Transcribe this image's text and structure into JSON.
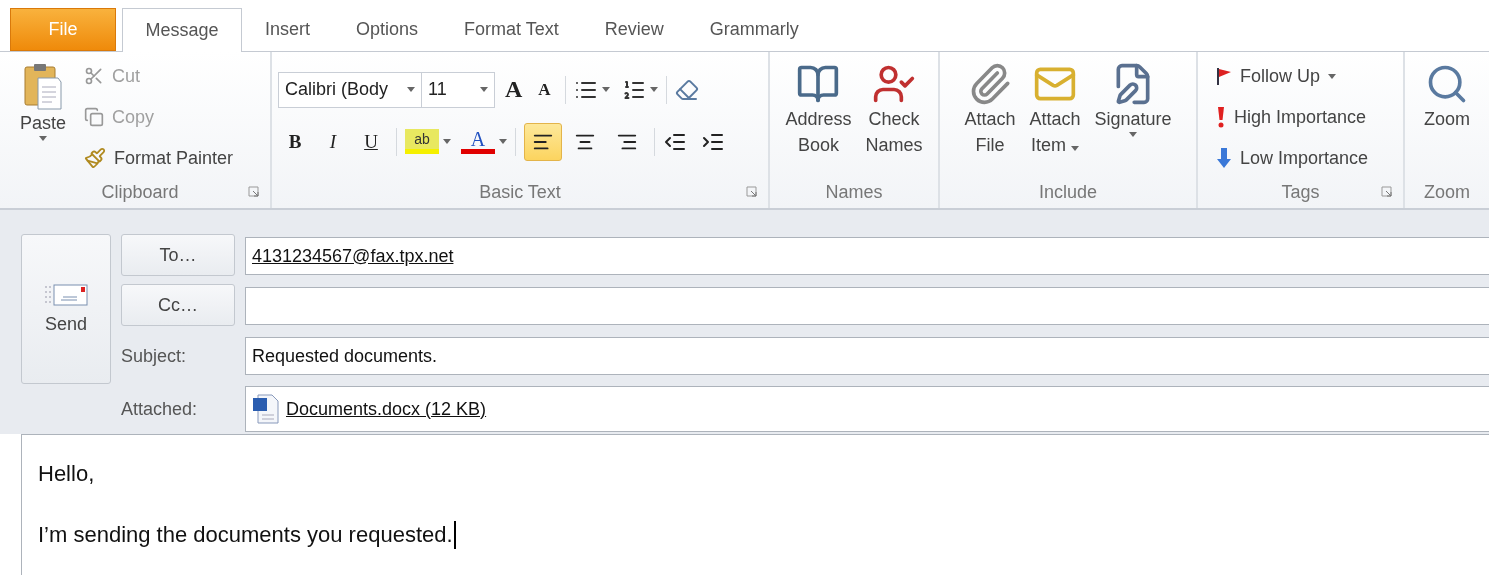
{
  "tabs": [
    {
      "label": "File",
      "kind": "file",
      "selected": false
    },
    {
      "label": "Message",
      "kind": "tab",
      "selected": true
    },
    {
      "label": "Insert",
      "kind": "tab",
      "selected": false
    },
    {
      "label": "Options",
      "kind": "tab",
      "selected": false
    },
    {
      "label": "Format Text",
      "kind": "tab",
      "selected": false
    },
    {
      "label": "Review",
      "kind": "tab",
      "selected": false
    },
    {
      "label": "Grammarly",
      "kind": "tab",
      "selected": false
    }
  ],
  "ribbon": {
    "clipboard": {
      "label": "Clipboard",
      "paste": "Paste",
      "actions": [
        {
          "label": "Cut",
          "kind": "cut",
          "disabled": true
        },
        {
          "label": "Copy",
          "kind": "copy",
          "disabled": true
        },
        {
          "label": "Format Painter",
          "kind": "painter",
          "disabled": false
        }
      ]
    },
    "basic_text": {
      "label": "Basic Text",
      "font_name": "Calibri (Body",
      "font_size": "11",
      "grow_font": "A",
      "shrink_font": "A",
      "highlight": "ab",
      "font_color": "A",
      "styles": [
        {
          "label": "B",
          "kind": "bold"
        },
        {
          "label": "I",
          "kind": "italic"
        },
        {
          "label": "U",
          "kind": "underline"
        }
      ],
      "alignment": [
        {
          "kind": "left",
          "selected": true
        },
        {
          "kind": "center",
          "selected": false
        },
        {
          "kind": "right",
          "selected": false
        }
      ]
    },
    "names": {
      "label": "Names",
      "buttons": [
        {
          "lines": [
            "Address",
            "Book"
          ],
          "kind": "address_book",
          "dropdown": false
        },
        {
          "lines": [
            "Check",
            "Names"
          ],
          "kind": "check_names",
          "dropdown": false
        }
      ]
    },
    "include": {
      "label": "Include",
      "buttons": [
        {
          "lines": [
            "Attach",
            "File"
          ],
          "kind": "attach_file",
          "dropdown": false
        },
        {
          "lines": [
            "Attach",
            "Item"
          ],
          "kind": "attach_item",
          "dropdown": true
        },
        {
          "lines": [
            "Signature"
          ],
          "kind": "signature",
          "dropdown": true
        }
      ]
    },
    "tags": {
      "label": "Tags",
      "items": [
        {
          "label": "Follow Up",
          "kind": "flag",
          "dropdown": true
        },
        {
          "label": "High Importance",
          "kind": "high",
          "dropdown": false
        },
        {
          "label": "Low Importance",
          "kind": "low",
          "dropdown": false
        }
      ]
    },
    "zoom": {
      "label": "Zoom",
      "button": "Zoom"
    }
  },
  "message": {
    "send": "Send",
    "to_button": "To…",
    "to_value": "4131234567@fax.tpx.net",
    "cc_button": "Cc…",
    "subject_label": "Subject:",
    "subject": "Requested documents.",
    "attached_label": "Attached:",
    "attachment": "Documents.docx (12 KB)"
  },
  "body": {
    "lines": [
      "Hello,",
      "I’m sending the documents you requested."
    ]
  }
}
